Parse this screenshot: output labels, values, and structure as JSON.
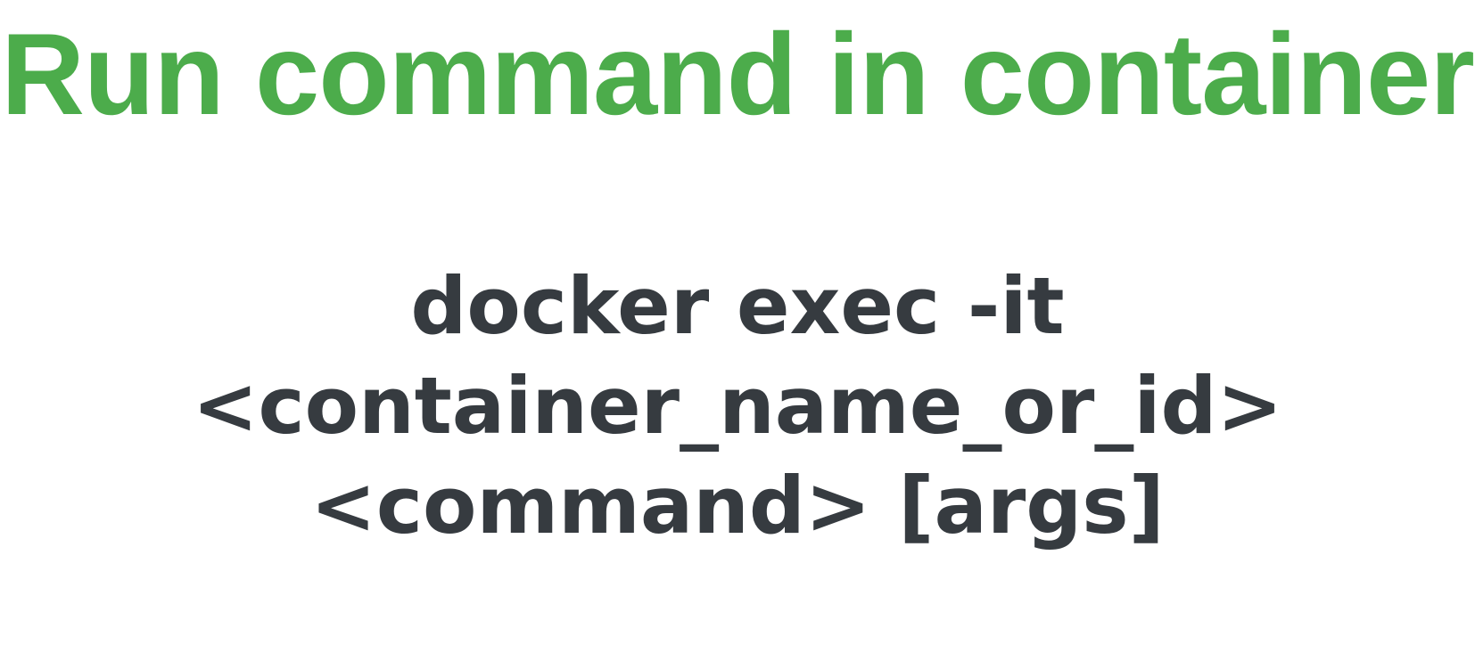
{
  "slide": {
    "title": "Run command in container",
    "command_lines": [
      "docker exec -it",
      "<container_name_or_id>",
      "<command> [args]"
    ]
  },
  "colors": {
    "title": "#4cac4b",
    "command": "#363b40",
    "background": "#ffffff"
  }
}
